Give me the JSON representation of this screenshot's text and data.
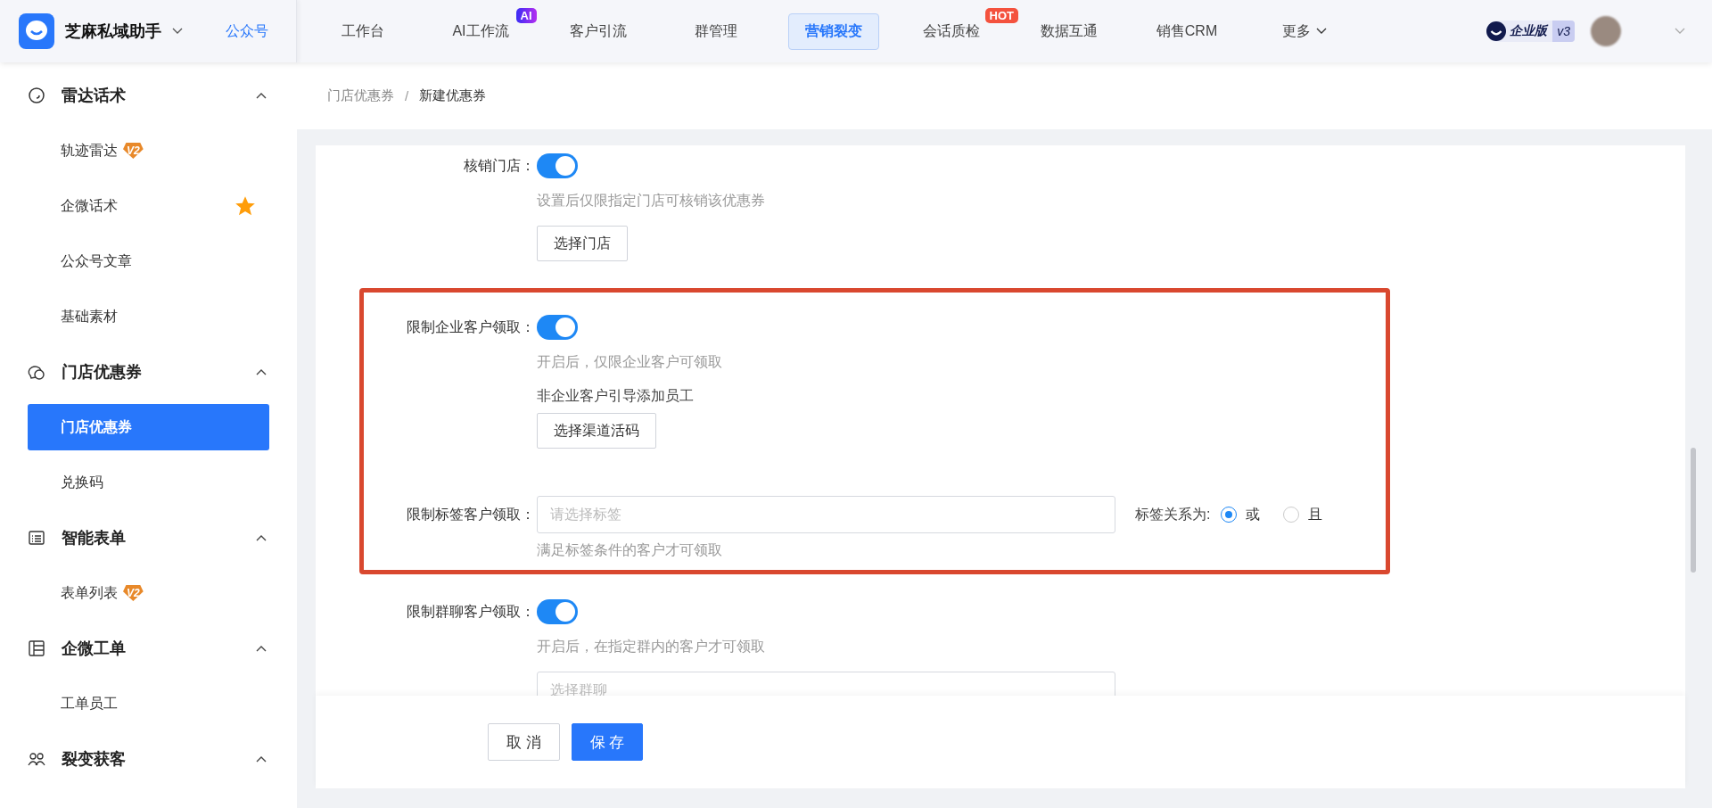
{
  "app": {
    "name": "芝麻私域助手",
    "link": "公众号"
  },
  "nav": [
    {
      "label": "工作台",
      "selected": false
    },
    {
      "label": "AI工作流",
      "selected": false,
      "badge": {
        "text": "AI",
        "kind": "ai"
      }
    },
    {
      "label": "客户引流",
      "selected": false
    },
    {
      "label": "群管理",
      "selected": false
    },
    {
      "label": "营销裂变",
      "selected": true
    },
    {
      "label": "会话质检",
      "selected": false,
      "badge": {
        "text": "HOT",
        "kind": "hot"
      }
    },
    {
      "label": "数据互通",
      "selected": false
    },
    {
      "label": "销售CRM",
      "selected": false
    },
    {
      "label": "更多",
      "selected": false,
      "dropdown": true
    }
  ],
  "edition": {
    "label": "企业版",
    "version": "v3"
  },
  "sidebar": [
    {
      "label": "雷达话术",
      "expanded": true,
      "children": [
        {
          "label": "轨迹雷达",
          "selected": false,
          "badge": "V2"
        },
        {
          "label": "企微话术",
          "selected": false,
          "starred": true
        },
        {
          "label": "公众号文章",
          "selected": false
        },
        {
          "label": "基础素材",
          "selected": false
        }
      ]
    },
    {
      "label": "门店优惠券",
      "expanded": true,
      "children": [
        {
          "label": "门店优惠券",
          "selected": true
        },
        {
          "label": "兑换码",
          "selected": false
        }
      ]
    },
    {
      "label": "智能表单",
      "expanded": true,
      "children": [
        {
          "label": "表单列表",
          "selected": false,
          "badge": "V2"
        }
      ]
    },
    {
      "label": "企微工单",
      "expanded": true,
      "children": [
        {
          "label": "工单员工",
          "selected": false
        }
      ]
    },
    {
      "label": "裂变获客",
      "expanded": true
    }
  ],
  "breadcrumb": [
    "门店优惠券",
    "新建优惠券"
  ],
  "breadcrumb_separator": "/",
  "form": {
    "sections": [
      {
        "highlighted": false,
        "fields": [
          {
            "kind": "switch",
            "label": "核销门店：",
            "on": true,
            "hint": "设置后仅限指定门店可核销该优惠券",
            "button": "选择门店"
          }
        ]
      },
      {
        "highlighted": true,
        "fields": [
          {
            "kind": "switch",
            "label": "限制企业客户领取：",
            "on": true,
            "hint": "开启后，仅限企业客户可领取",
            "note": "非企业客户引导添加员工",
            "button": "选择渠道活码"
          },
          {
            "kind": "select",
            "label": "限制标签客户领取：",
            "placeholder": "请选择标签",
            "relation": {
              "label": "标签关系为:",
              "options": [
                {
                  "label": "或",
                  "selected": true
                },
                {
                  "label": "且",
                  "selected": false
                }
              ]
            },
            "hint": "满足标签条件的客户才可领取"
          }
        ]
      },
      {
        "highlighted": false,
        "fields": [
          {
            "kind": "switch",
            "label": "限制群聊客户领取：",
            "on": true,
            "hint": "开启后，在指定群内的客户才可领取",
            "input_placeholder": "选择群聊"
          }
        ]
      }
    ]
  },
  "footer": [
    {
      "label": "取 消",
      "kind": "default"
    },
    {
      "label": "保 存",
      "kind": "primary"
    }
  ]
}
